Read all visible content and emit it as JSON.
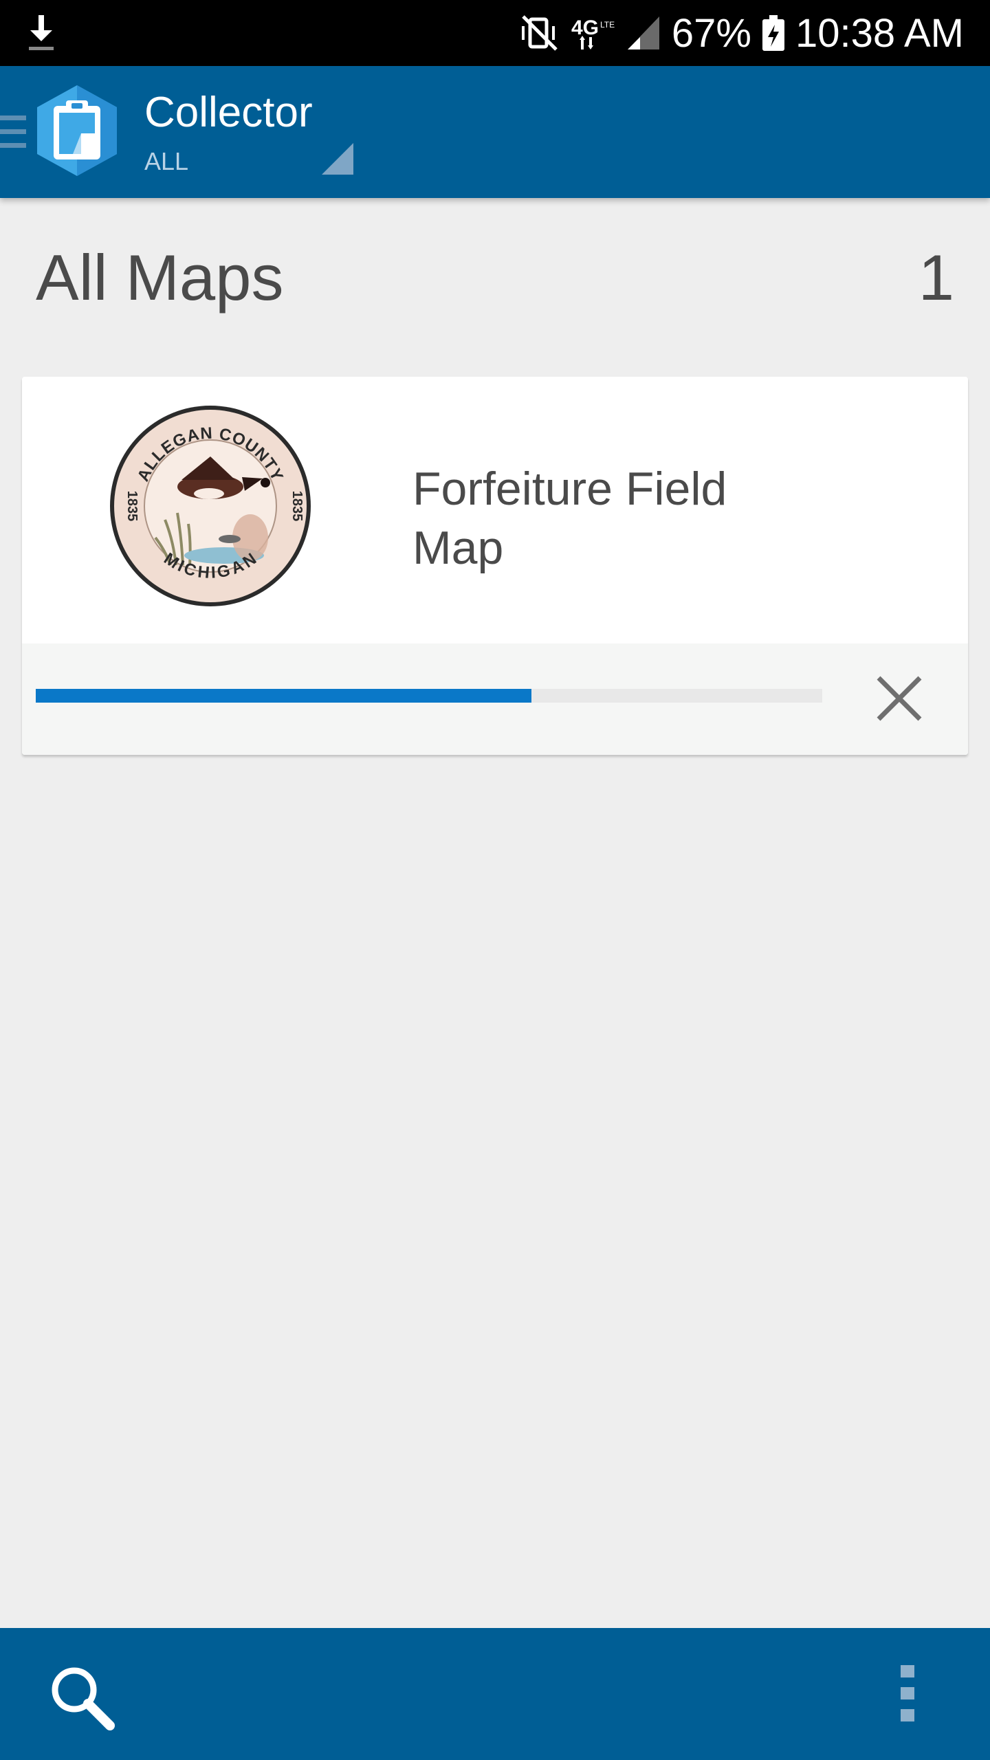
{
  "status_bar": {
    "battery_percent": "67%",
    "time": "10:38 AM",
    "network_label": "4G LTE",
    "icons": [
      "download-icon",
      "vibrate-mute-icon",
      "4g-lte-icon",
      "signal-icon",
      "battery-charging-icon"
    ]
  },
  "app_bar": {
    "title": "Collector",
    "filter": "ALL",
    "icons": [
      "menu-icon",
      "collector-logo-icon",
      "dropdown-corner-icon"
    ]
  },
  "section": {
    "title": "All Maps",
    "count": "1"
  },
  "maps": [
    {
      "title": "Forfeiture Field Map",
      "thumbnail_seal": {
        "top_text": "ALLEGAN COUNTY",
        "bottom_text": "MICHIGAN",
        "left_year": "1835",
        "right_year": "1835"
      },
      "download_progress_percent": 63
    }
  ],
  "bottom_bar": {
    "icons": [
      "search-icon",
      "overflow-menu-icon"
    ]
  },
  "colors": {
    "app_bar": "#005e95",
    "progress": "#0a78c8",
    "background": "#eeeeee"
  }
}
